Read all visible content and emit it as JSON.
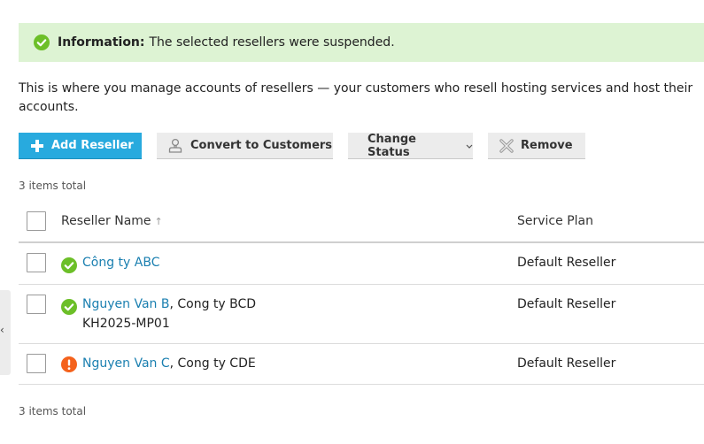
{
  "message": {
    "label": "Information:",
    "text": "The selected resellers were suspended."
  },
  "intro": "This is where you manage accounts of resellers — your customers who resell hosting services and host their accounts.",
  "toolbar": {
    "add_label": "Add Reseller",
    "convert_label": "Convert to Customers",
    "status_label": "Change Status",
    "remove_label": "Remove"
  },
  "summary": {
    "top": "3 items total",
    "bottom": "3 items total"
  },
  "table": {
    "col_name": "Reseller Name",
    "col_plan": "Service Plan",
    "sort_glyph": "↑",
    "rows": [
      {
        "status": "active",
        "name": "Công ty ABC",
        "company": "",
        "login": "",
        "plan": "Default Reseller"
      },
      {
        "status": "active",
        "name": "Nguyen Van B",
        "company": ", Cong ty BCD",
        "login": "KH2025-MP01",
        "plan": "Default Reseller"
      },
      {
        "status": "suspended",
        "name": "Nguyen Van C",
        "company": ", Cong ty CDE",
        "login": "",
        "plan": "Default Reseller"
      }
    ]
  },
  "side_handle_glyph": "‹",
  "colors": {
    "active": "#6cbf28",
    "suspended": "#f4621c",
    "link": "#1a7fb0",
    "primary": "#28aade"
  }
}
